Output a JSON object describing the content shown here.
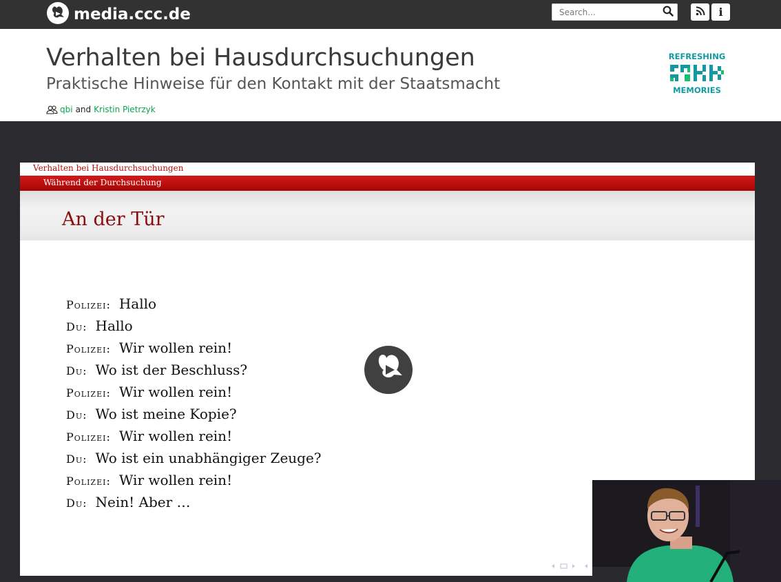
{
  "topbar": {
    "site_name": "media.ccc.de",
    "search_placeholder": "Search...",
    "icons": {
      "logo": "ccc-logo-icon",
      "search": "search-icon",
      "rss": "rss-icon",
      "info": "info-icon"
    }
  },
  "event": {
    "title": "Verhalten bei Hausdurchsuchungen",
    "subtitle": "Praktische Hinweise für den Kontakt mit der Staatsmacht",
    "persons": [
      "qbi",
      "Kristin Pietrzyk"
    ],
    "persons_separator": "and",
    "conference_logo_text": {
      "top": "REFRESHING",
      "bottom": "MEMORIES"
    }
  },
  "slide": {
    "document_title": "Verhalten bei Hausdurchsuchungen",
    "section": "Während der Durchsuchung",
    "heading": "An der Tür",
    "dialog": [
      {
        "speaker": "Polizei:",
        "text": "Hallo"
      },
      {
        "speaker": "Du:",
        "text": "Hallo"
      },
      {
        "speaker": "Polizei:",
        "text": "Wir wollen rein!"
      },
      {
        "speaker": "Du:",
        "text": "Wo ist der Beschluss?"
      },
      {
        "speaker": "Polizei:",
        "text": "Wir wollen rein!"
      },
      {
        "speaker": "Du:",
        "text": "Wo ist meine Kopie?"
      },
      {
        "speaker": "Polizei:",
        "text": "Wir wollen rein!"
      },
      {
        "speaker": "Du:",
        "text": "Wo ist ein unabhängiger Zeuge?"
      },
      {
        "speaker": "Polizei:",
        "text": "Wir wollen rein!"
      },
      {
        "speaker": "Du:",
        "text": "Nein! Aber …"
      }
    ]
  },
  "colors": {
    "topbar_bg": "#323232",
    "link_green": "#0aa64f",
    "slide_red": "#b01010",
    "conference_teal": "#139aa0",
    "conference_green": "#19c072"
  }
}
